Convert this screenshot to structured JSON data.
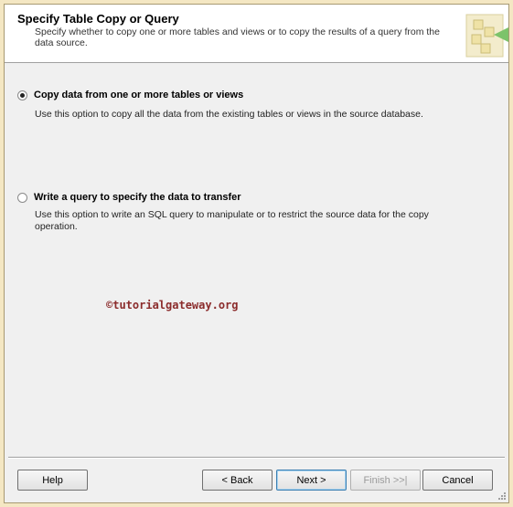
{
  "header": {
    "title": "Specify Table Copy or Query",
    "description": "Specify whether to copy one or more tables and views or to copy the results of a query from the data source."
  },
  "options": [
    {
      "label": "Copy data from one or more tables or views",
      "description": "Use this option to copy all the data from the existing tables or views in the source database.",
      "selected": true
    },
    {
      "label": "Write a query to specify the data to transfer",
      "description": "Use this option to write an SQL query to manipulate or to restrict the source data for the copy operation.",
      "selected": false
    }
  ],
  "watermark": "©tutorialgateway.org",
  "buttons": {
    "help": "Help",
    "back": "< Back",
    "next": "Next >",
    "finish": "Finish >>|",
    "cancel": "Cancel"
  },
  "colors": {
    "window_border": "#f4e7c3",
    "watermark": "#8b2c2c",
    "default_button_border": "#3c7fb1"
  }
}
